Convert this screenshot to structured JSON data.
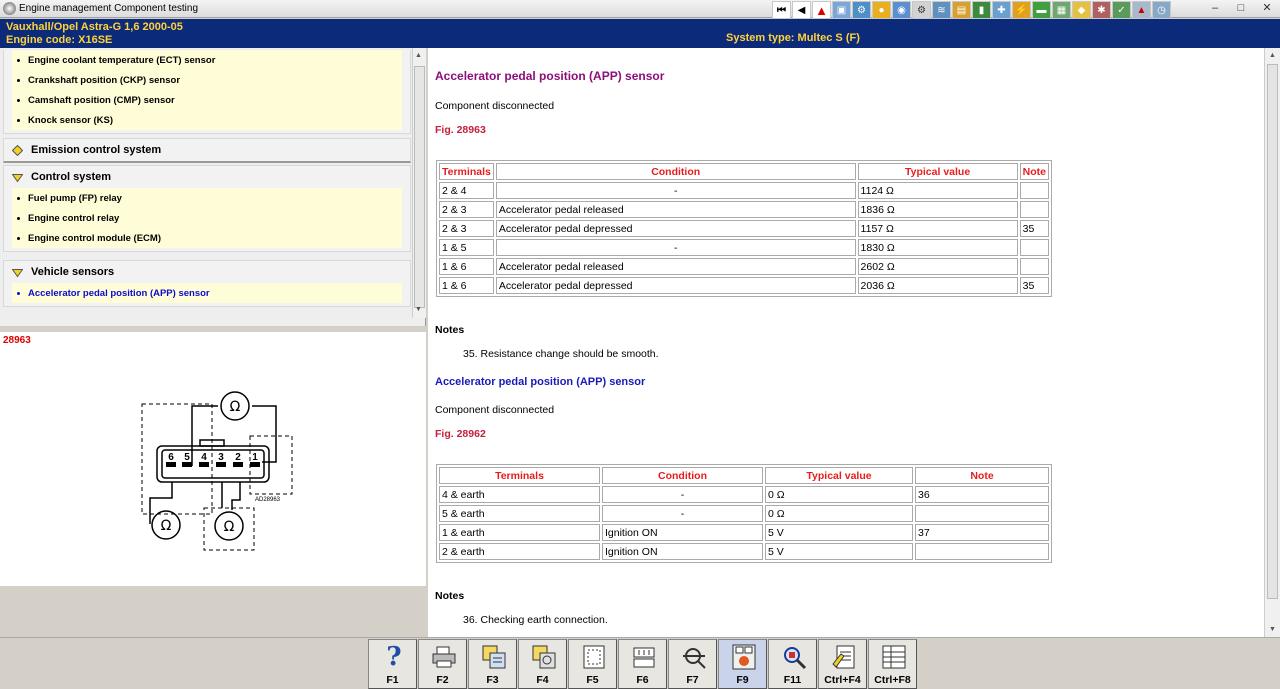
{
  "window": {
    "title": "Engine management Component testing",
    "controls": [
      "–",
      "□",
      "✕"
    ]
  },
  "vehicle": {
    "line1": "Vauxhall/Opel  Astra-G  1,6  2000-05",
    "line2": "Engine code: X16SE",
    "system_type": "System type: Multec S (F)"
  },
  "toolbar": {
    "icons": [
      "first-icon",
      "prev-icon",
      "warning-icon",
      "photo-icon",
      "engine-icon",
      "fuel-icon",
      "sensor-icon",
      "gear-icon",
      "exhaust-icon",
      "ecu-icon",
      "lamp-icon",
      "tools-icon",
      "ignition-icon",
      "battery-icon",
      "diagram-icon",
      "relay-icon",
      "spark-icon",
      "test-icon",
      "wheel-icon",
      "clock-icon"
    ]
  },
  "tree": {
    "group0_items": [
      "Engine coolant temperature (ECT) sensor",
      "Crankshaft position (CKP) sensor",
      "Camshaft position (CMP) sensor",
      "Knock sensor (KS)"
    ],
    "group1": {
      "label": "Emission control system"
    },
    "group2": {
      "label": "Control system",
      "items": [
        "Fuel pump (FP) relay",
        "Engine control relay",
        "Engine control module (ECM)"
      ]
    },
    "group3": {
      "label": "Vehicle sensors",
      "items": [
        "Accelerator pedal position (APP) sensor"
      ]
    }
  },
  "figure": {
    "label": "28963",
    "code": "AD28963",
    "pins": [
      "6",
      "5",
      "4",
      "3",
      "2",
      "1"
    ],
    "ohm": "Ω"
  },
  "content": {
    "section1": {
      "title": "Accelerator pedal position (APP) sensor",
      "status": "Component disconnected",
      "fig": "Fig. 28963",
      "headers": [
        "Terminals",
        "Condition",
        "Typical value",
        "Note"
      ],
      "rows": [
        [
          "2 & 4",
          "-",
          "1124 Ω",
          ""
        ],
        [
          "2 & 3",
          "Accelerator pedal released",
          "1836 Ω",
          ""
        ],
        [
          "2 & 3",
          "Accelerator pedal depressed",
          "1157 Ω",
          "35"
        ],
        [
          "1 & 5",
          "-",
          "1830 Ω",
          ""
        ],
        [
          "1 & 6",
          "Accelerator pedal released",
          "2602 Ω",
          ""
        ],
        [
          "1 & 6",
          "Accelerator pedal depressed",
          "2036 Ω",
          "35"
        ]
      ],
      "notes_title": "Notes",
      "note": "35. Resistance change should be smooth."
    },
    "section2": {
      "title": "Accelerator pedal position (APP) sensor",
      "status": "Component disconnected",
      "fig": "Fig. 28962",
      "headers": [
        "Terminals",
        "Condition",
        "Typical value",
        "Note"
      ],
      "rows": [
        [
          "4 & earth",
          "-",
          "0 Ω",
          "36"
        ],
        [
          "5 & earth",
          "-",
          "0 Ω",
          ""
        ],
        [
          "1 & earth",
          "Ignition ON",
          "5 V",
          "37"
        ],
        [
          "2 & earth",
          "Ignition ON",
          "5 V",
          ""
        ]
      ],
      "notes_title": "Notes",
      "note": "36. Checking earth connection."
    }
  },
  "fkeys": [
    {
      "label": "F1",
      "icon": "help-icon"
    },
    {
      "label": "F2",
      "icon": "print-icon"
    },
    {
      "label": "F3",
      "icon": "copy-icon"
    },
    {
      "label": "F4",
      "icon": "data-icon"
    },
    {
      "label": "F5",
      "icon": "document-icon"
    },
    {
      "label": "F6",
      "icon": "connector-icon"
    },
    {
      "label": "F7",
      "icon": "tools-icon"
    },
    {
      "label": "F9",
      "icon": "fault-code-icon"
    },
    {
      "label": "F11",
      "icon": "search-icon"
    },
    {
      "label": "Ctrl+F4",
      "icon": "notepad-icon"
    },
    {
      "label": "Ctrl+F8",
      "icon": "list-icon"
    }
  ]
}
